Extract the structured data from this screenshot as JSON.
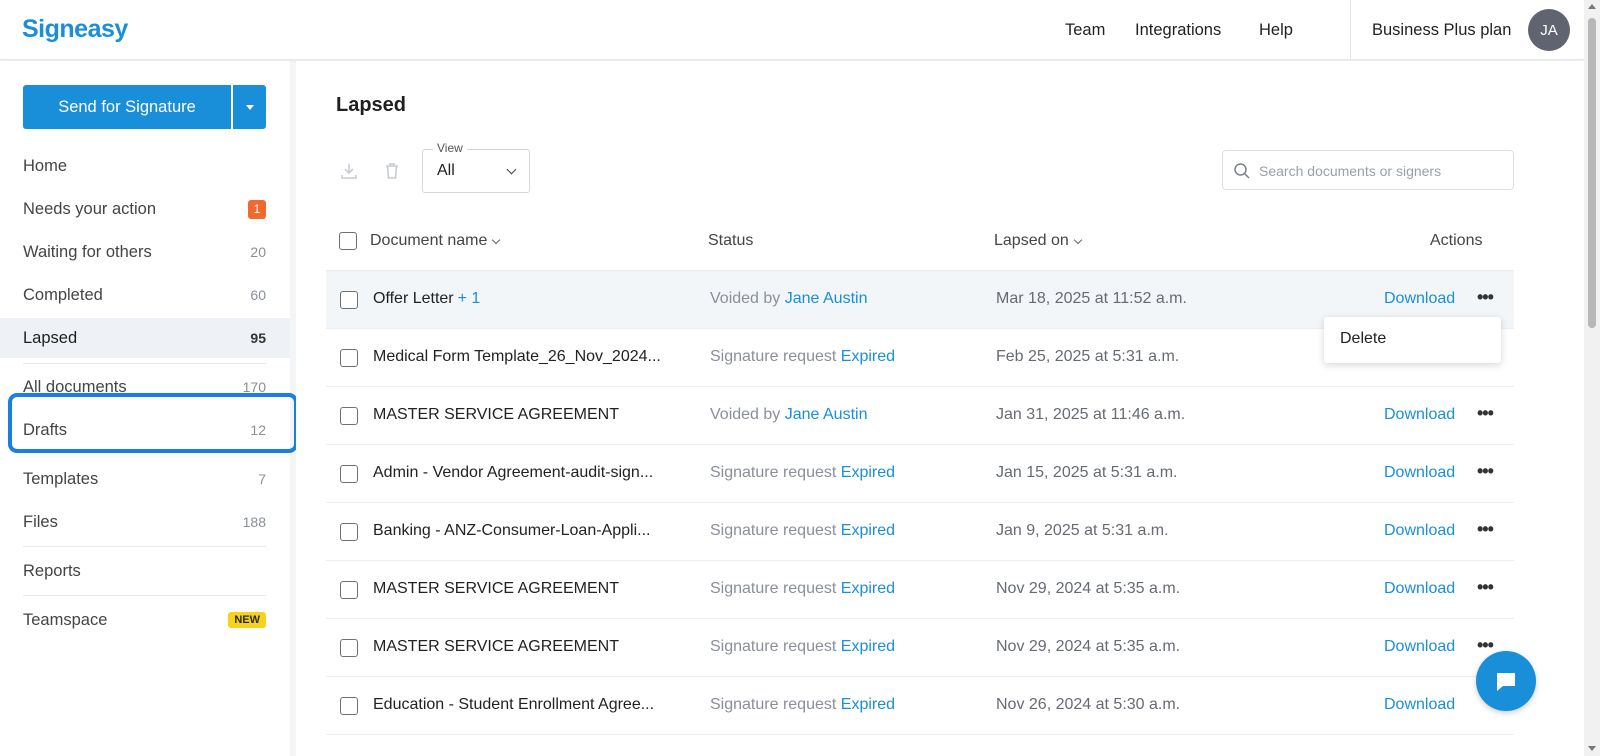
{
  "app": {
    "logo": "Signeasy"
  },
  "topnav": {
    "team": "Team",
    "integrations": "Integrations",
    "help": "Help",
    "plan": "Business Plus plan",
    "avatar": "JA"
  },
  "sidebar": {
    "send_button": "Send for Signature",
    "items": [
      {
        "label": "Home",
        "count": ""
      },
      {
        "label": "Needs your action",
        "count": "1"
      },
      {
        "label": "Waiting for others",
        "count": "20"
      },
      {
        "label": "Completed",
        "count": "60"
      },
      {
        "label": "Lapsed",
        "count": "95"
      },
      {
        "label": "All documents",
        "count": "170"
      },
      {
        "label": "Drafts",
        "count": "12"
      },
      {
        "label": "Templates",
        "count": "7"
      },
      {
        "label": "Files",
        "count": "188"
      },
      {
        "label": "Reports",
        "count": ""
      },
      {
        "label": "Teamspace",
        "badge": "NEW"
      }
    ]
  },
  "main": {
    "title": "Lapsed",
    "view": {
      "legend": "View",
      "value": "All"
    },
    "search": {
      "placeholder": "Search documents or signers"
    },
    "columns": {
      "name": "Document name",
      "status": "Status",
      "lapsed": "Lapsed on",
      "actions": "Actions"
    },
    "rows": [
      {
        "name": "Offer Letter",
        "extra": "+ 1",
        "status_prefix": "Voided by",
        "status_value": "Jane Austin",
        "date": "Mar 18, 2025 at 11:52 a.m.",
        "action": "Download"
      },
      {
        "name": "Medical Form Template_26_Nov_2024...",
        "extra": "",
        "status_prefix": "Signature request",
        "status_value": "Expired",
        "date": "Feb 25, 2025 at 5:31 a.m.",
        "action": ""
      },
      {
        "name": "MASTER SERVICE AGREEMENT",
        "extra": "",
        "status_prefix": "Voided by",
        "status_value": "Jane Austin",
        "date": "Jan 31, 2025 at 11:46 a.m.",
        "action": "Download"
      },
      {
        "name": "Admin - Vendor Agreement-audit-sign...",
        "extra": "",
        "status_prefix": "Signature request",
        "status_value": "Expired",
        "date": "Jan 15, 2025 at 5:31 a.m.",
        "action": "Download"
      },
      {
        "name": "Banking - ANZ-Consumer-Loan-Appli...",
        "extra": "",
        "status_prefix": "Signature request",
        "status_value": "Expired",
        "date": "Jan 9, 2025 at 5:31 a.m.",
        "action": "Download"
      },
      {
        "name": "MASTER SERVICE AGREEMENT",
        "extra": "",
        "status_prefix": "Signature request",
        "status_value": "Expired",
        "date": "Nov 29, 2024 at 5:35 a.m.",
        "action": "Download"
      },
      {
        "name": "MASTER SERVICE AGREEMENT",
        "extra": "",
        "status_prefix": "Signature request",
        "status_value": "Expired",
        "date": "Nov 29, 2024 at 5:35 a.m.",
        "action": "Download"
      },
      {
        "name": "Education - Student Enrollment Agree...",
        "extra": "",
        "status_prefix": "Signature request",
        "status_value": "Expired",
        "date": "Nov 26, 2024 at 5:30 a.m.",
        "action": "Download"
      }
    ],
    "row_menu": {
      "delete": "Delete"
    }
  },
  "colors": {
    "accent": "#1a8fd9",
    "badge": "#f06a2e",
    "new_badge": "#f7d21b",
    "highlight": "#1a7fe0"
  }
}
